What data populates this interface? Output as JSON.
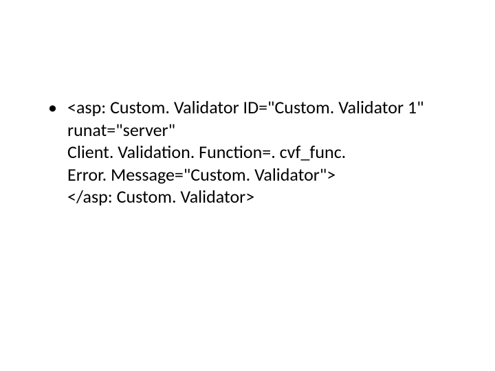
{
  "slide": {
    "bullet": {
      "lines": [
        "<asp: Custom. Validator ID=\"Custom. Validator 1\"",
        "runat=\"server\"",
        "Client. Validation. Function=. cvf_func.",
        "Error. Message=\"Custom. Validator\">",
        "</asp: Custom. Validator>"
      ]
    }
  }
}
